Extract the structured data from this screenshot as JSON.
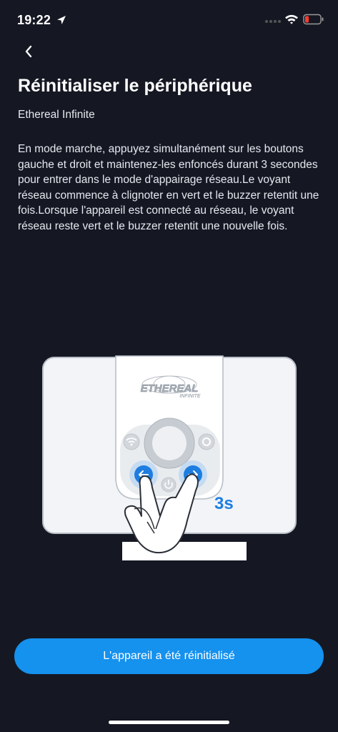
{
  "status_bar": {
    "time": "19:22",
    "icons": [
      "location-arrow-icon",
      "signal-icon",
      "wifi-icon",
      "battery-low-icon"
    ]
  },
  "header": {
    "back_icon": "chevron-left-icon",
    "title": "Réinitialiser le périphérique",
    "subtitle": "Ethereal Infinite"
  },
  "main": {
    "instructions": "En mode marche, appuyez simultanément sur les boutons gauche et droit et maintenez-les enfoncés durant 3 secondes pour entrer dans le mode d'appairage réseau.Le voyant réseau commence à clignoter en vert et le buzzer retentit une fois.Lorsque l'appareil est connecté au réseau, le voyant réseau reste vert et le buzzer retentit une nouvelle fois.",
    "illustration": {
      "brand_text": "ETHEREAL",
      "brand_subtext": "INFINITE",
      "duration_label": "3s"
    }
  },
  "footer": {
    "confirm_label": "L'appareil a été réinitialisé"
  },
  "colors": {
    "background": "#151823",
    "accent": "#1591ee",
    "button_highlight": "#1e7de0"
  }
}
